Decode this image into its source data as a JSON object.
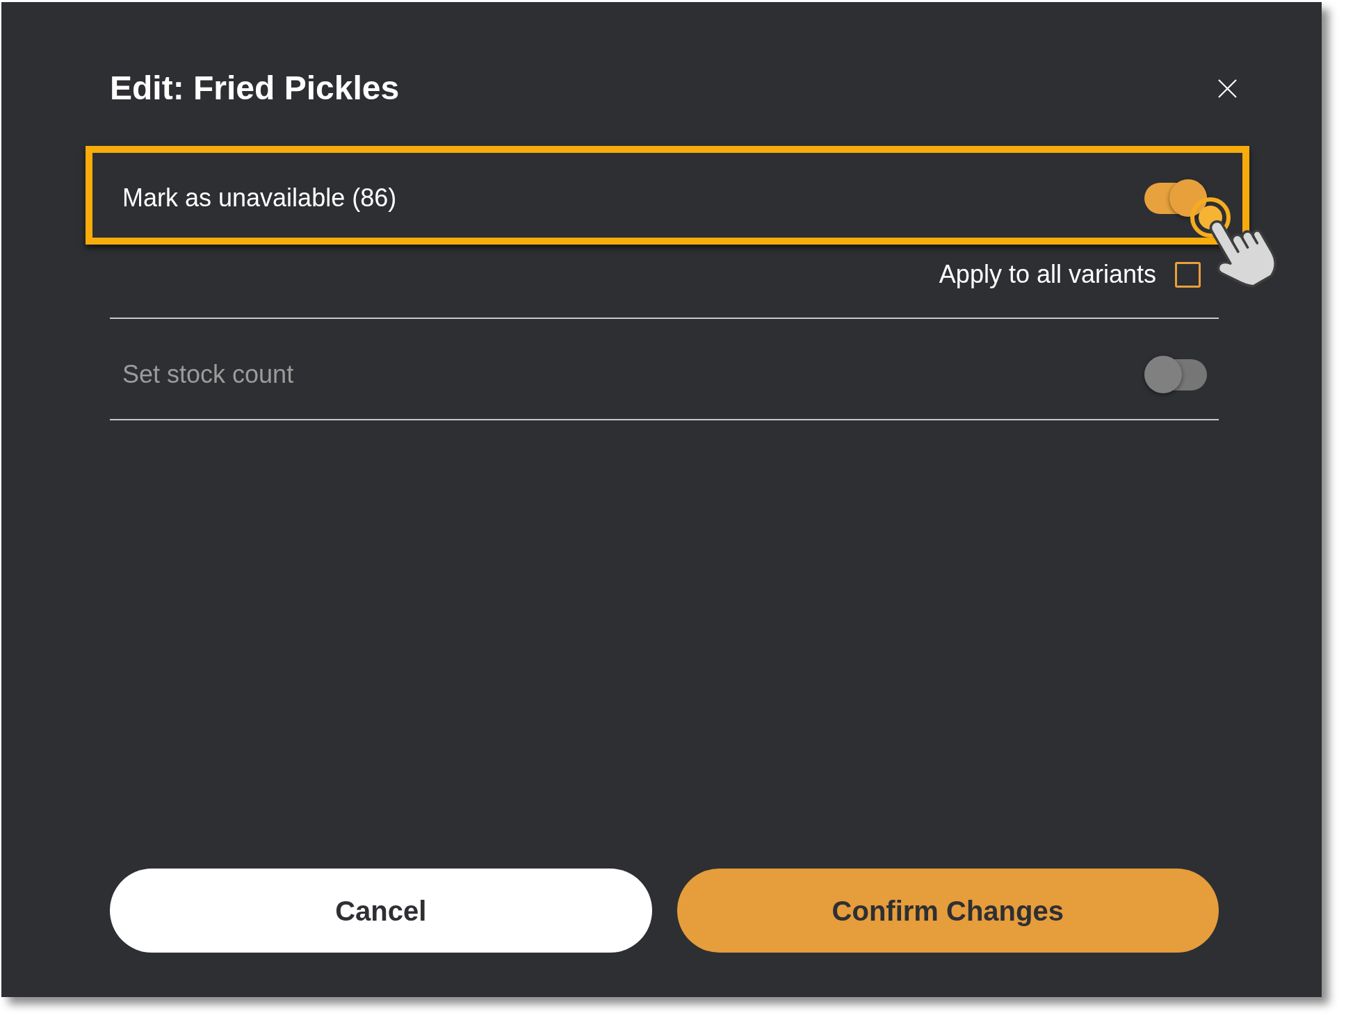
{
  "dialog": {
    "title": "Edit: Fried Pickles"
  },
  "options": [
    {
      "label": "Mark as unavailable (86)",
      "on": true,
      "highlighted": true,
      "sub_option": {
        "label": "Apply to all variants",
        "checked": false
      }
    },
    {
      "label": "Set stock count",
      "on": false,
      "highlighted": false
    }
  ],
  "buttons": [
    {
      "label": "Cancel",
      "kind": "secondary"
    },
    {
      "label": "Confirm Changes",
      "kind": "primary"
    }
  ]
}
